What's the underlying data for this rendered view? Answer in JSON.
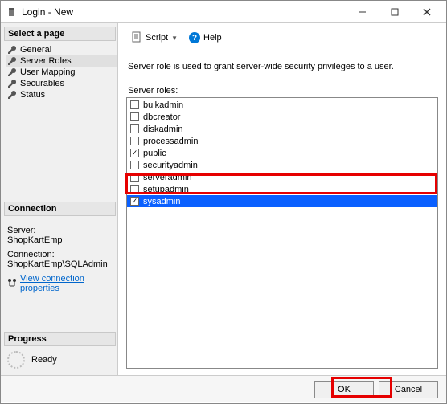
{
  "title": "Login - New",
  "sidebar": {
    "select_header": "Select a page",
    "pages": [
      "General",
      "Server Roles",
      "User Mapping",
      "Securables",
      "Status"
    ],
    "selected_index": 1,
    "connection_header": "Connection",
    "server_label": "Server:",
    "server_value": "ShopKartEmp",
    "connection_label": "Connection:",
    "connection_value": "ShopKartEmp\\SQLAdmin",
    "view_conn_link": "View connection properties",
    "progress_header": "Progress",
    "progress_status": "Ready"
  },
  "toolbar": {
    "script_label": "Script",
    "help_label": "Help"
  },
  "content": {
    "description": "Server role is used to grant server-wide security privileges to a user.",
    "roles_label": "Server roles:",
    "roles": [
      {
        "name": "bulkadmin",
        "checked": false,
        "selected": false
      },
      {
        "name": "dbcreator",
        "checked": false,
        "selected": false
      },
      {
        "name": "diskadmin",
        "checked": false,
        "selected": false
      },
      {
        "name": "processadmin",
        "checked": false,
        "selected": false
      },
      {
        "name": "public",
        "checked": true,
        "selected": false
      },
      {
        "name": "securityadmin",
        "checked": false,
        "selected": false
      },
      {
        "name": "serveradmin",
        "checked": false,
        "selected": false
      },
      {
        "name": "setupadmin",
        "checked": false,
        "selected": false
      },
      {
        "name": "sysadmin",
        "checked": true,
        "selected": true
      }
    ]
  },
  "buttons": {
    "ok": "OK",
    "cancel": "Cancel"
  }
}
